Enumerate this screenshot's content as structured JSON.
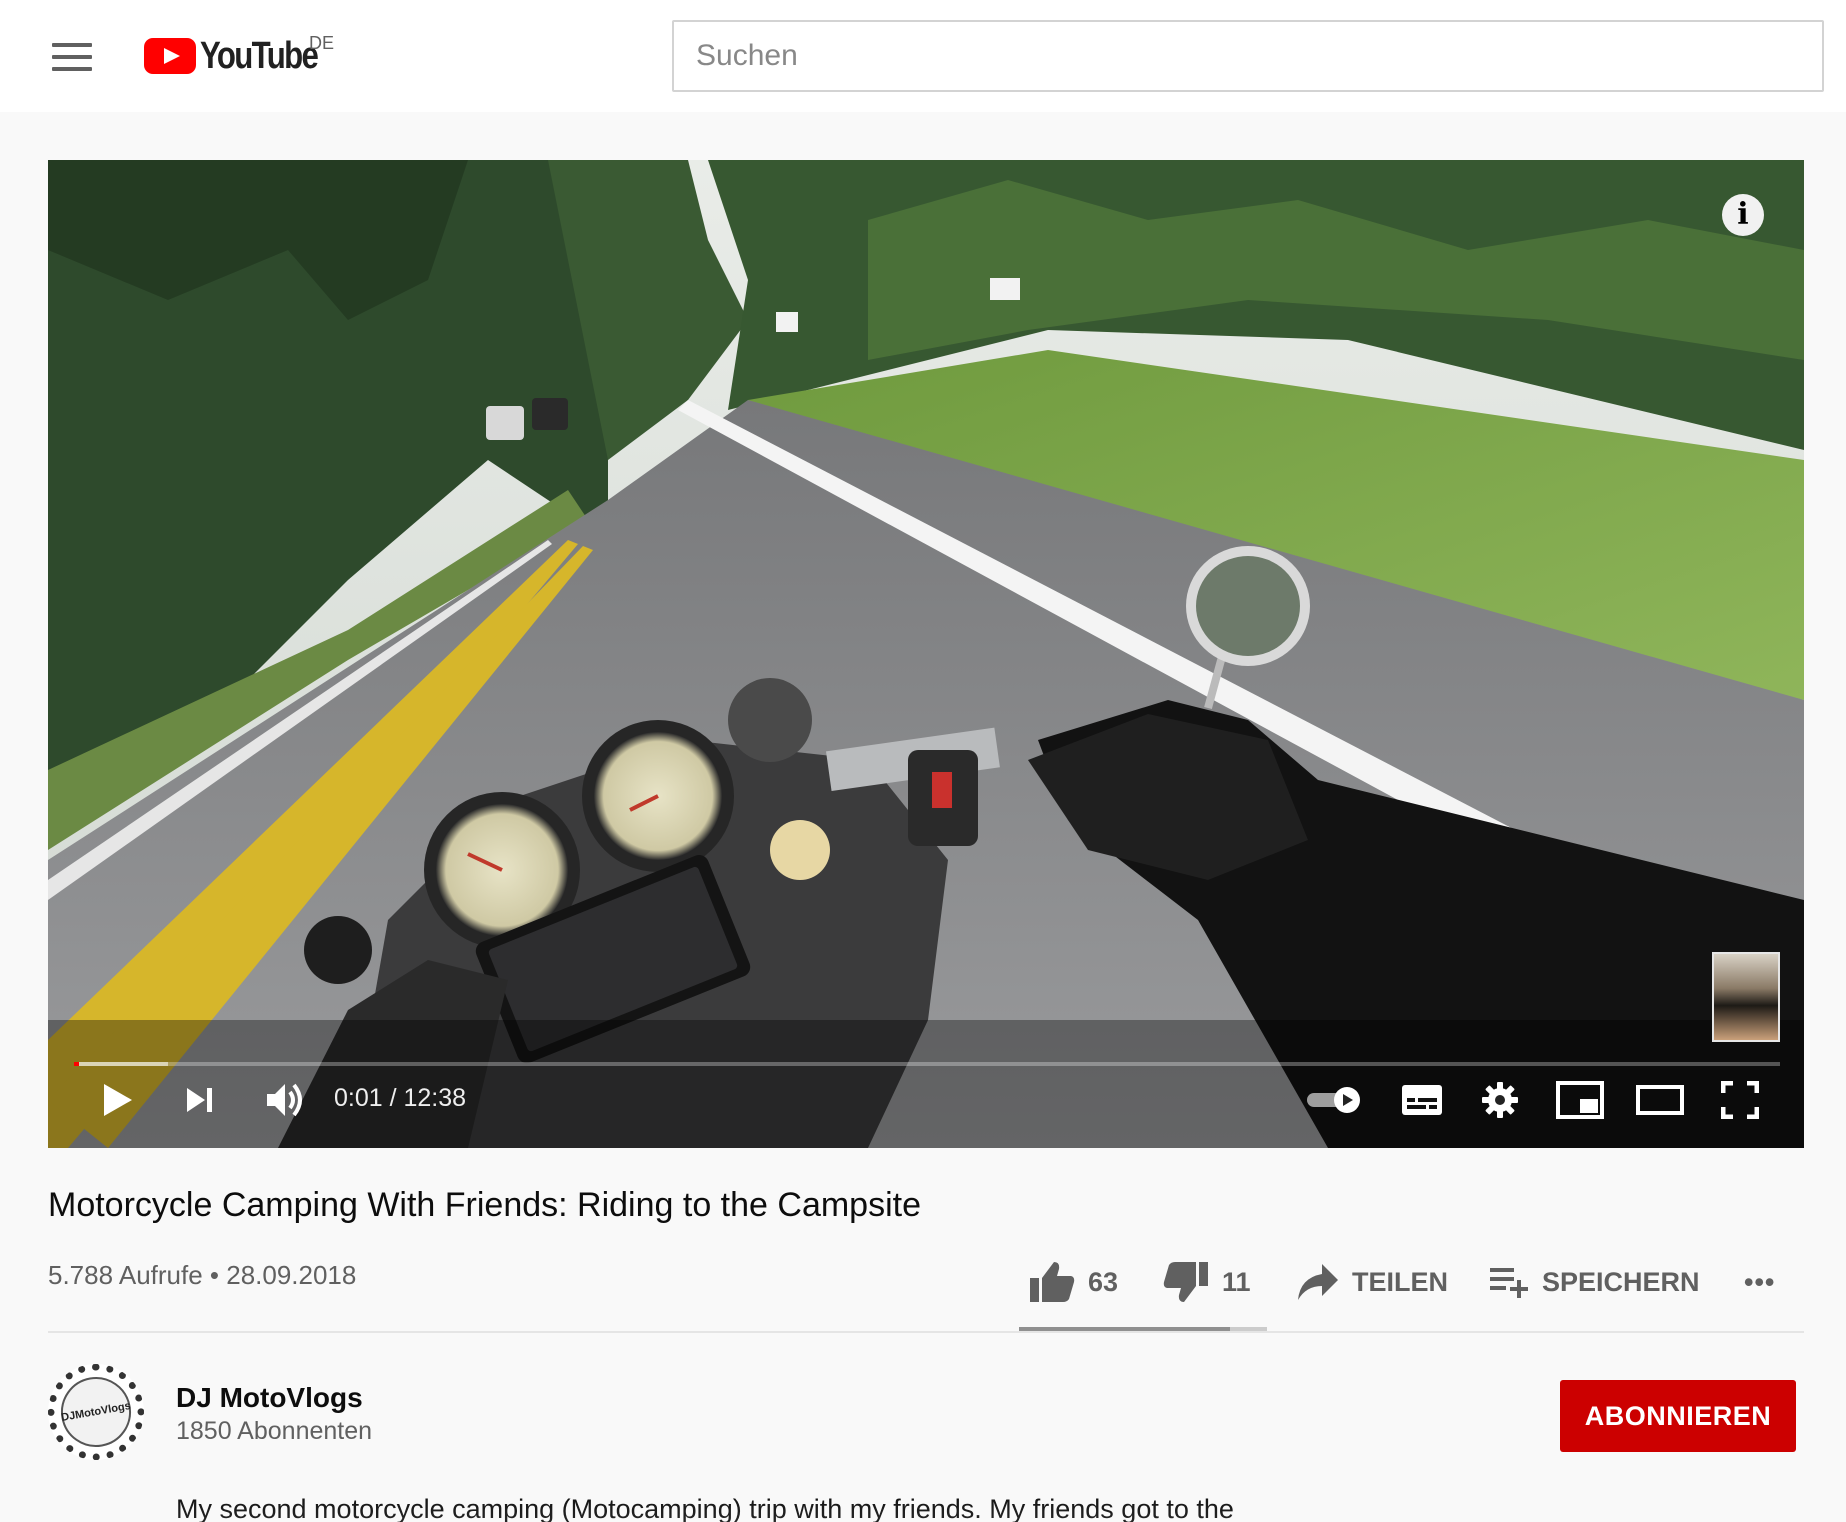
{
  "header": {
    "logo_text": "YouTube",
    "country_code": "DE",
    "search_placeholder": "Suchen"
  },
  "player": {
    "current_time": "0:01",
    "duration": "12:38",
    "time_display": "0:01 / 12:38",
    "played_fraction": 0.0013,
    "buffered_fraction": 0.055,
    "autoplay_on": true,
    "info_label": "i",
    "accent_color": "#ff0000"
  },
  "video": {
    "title": "Motorcycle Camping With Friends: Riding to the Campsite",
    "views_and_date": "5.788 Aufrufe • 28.09.2018"
  },
  "actions": {
    "likes": "63",
    "dislikes": "11",
    "share_label": "TEILEN",
    "save_label": "SPEICHERN",
    "more_label": "•••",
    "like_ratio": 0.85
  },
  "channel": {
    "name": "DJ MotoVlogs",
    "subscribers": "1850 Abonnenten",
    "avatar_text": "DJMotoVlogs",
    "subscribe_label": "ABONNIEREN",
    "subscribe_color": "#cc0000"
  },
  "description": {
    "text": "My second motorcycle camping (Motocamping) trip with my friends. My friends got to the"
  },
  "icons": [
    "menu-icon",
    "youtube-logo-icon",
    "play-icon",
    "next-icon",
    "volume-icon",
    "autoplay-toggle-icon",
    "subtitles-icon",
    "settings-icon",
    "miniplayer-icon",
    "theater-mode-icon",
    "fullscreen-icon",
    "thumbs-up-icon",
    "thumbs-down-icon",
    "share-icon",
    "playlist-add-icon",
    "more-icon"
  ]
}
